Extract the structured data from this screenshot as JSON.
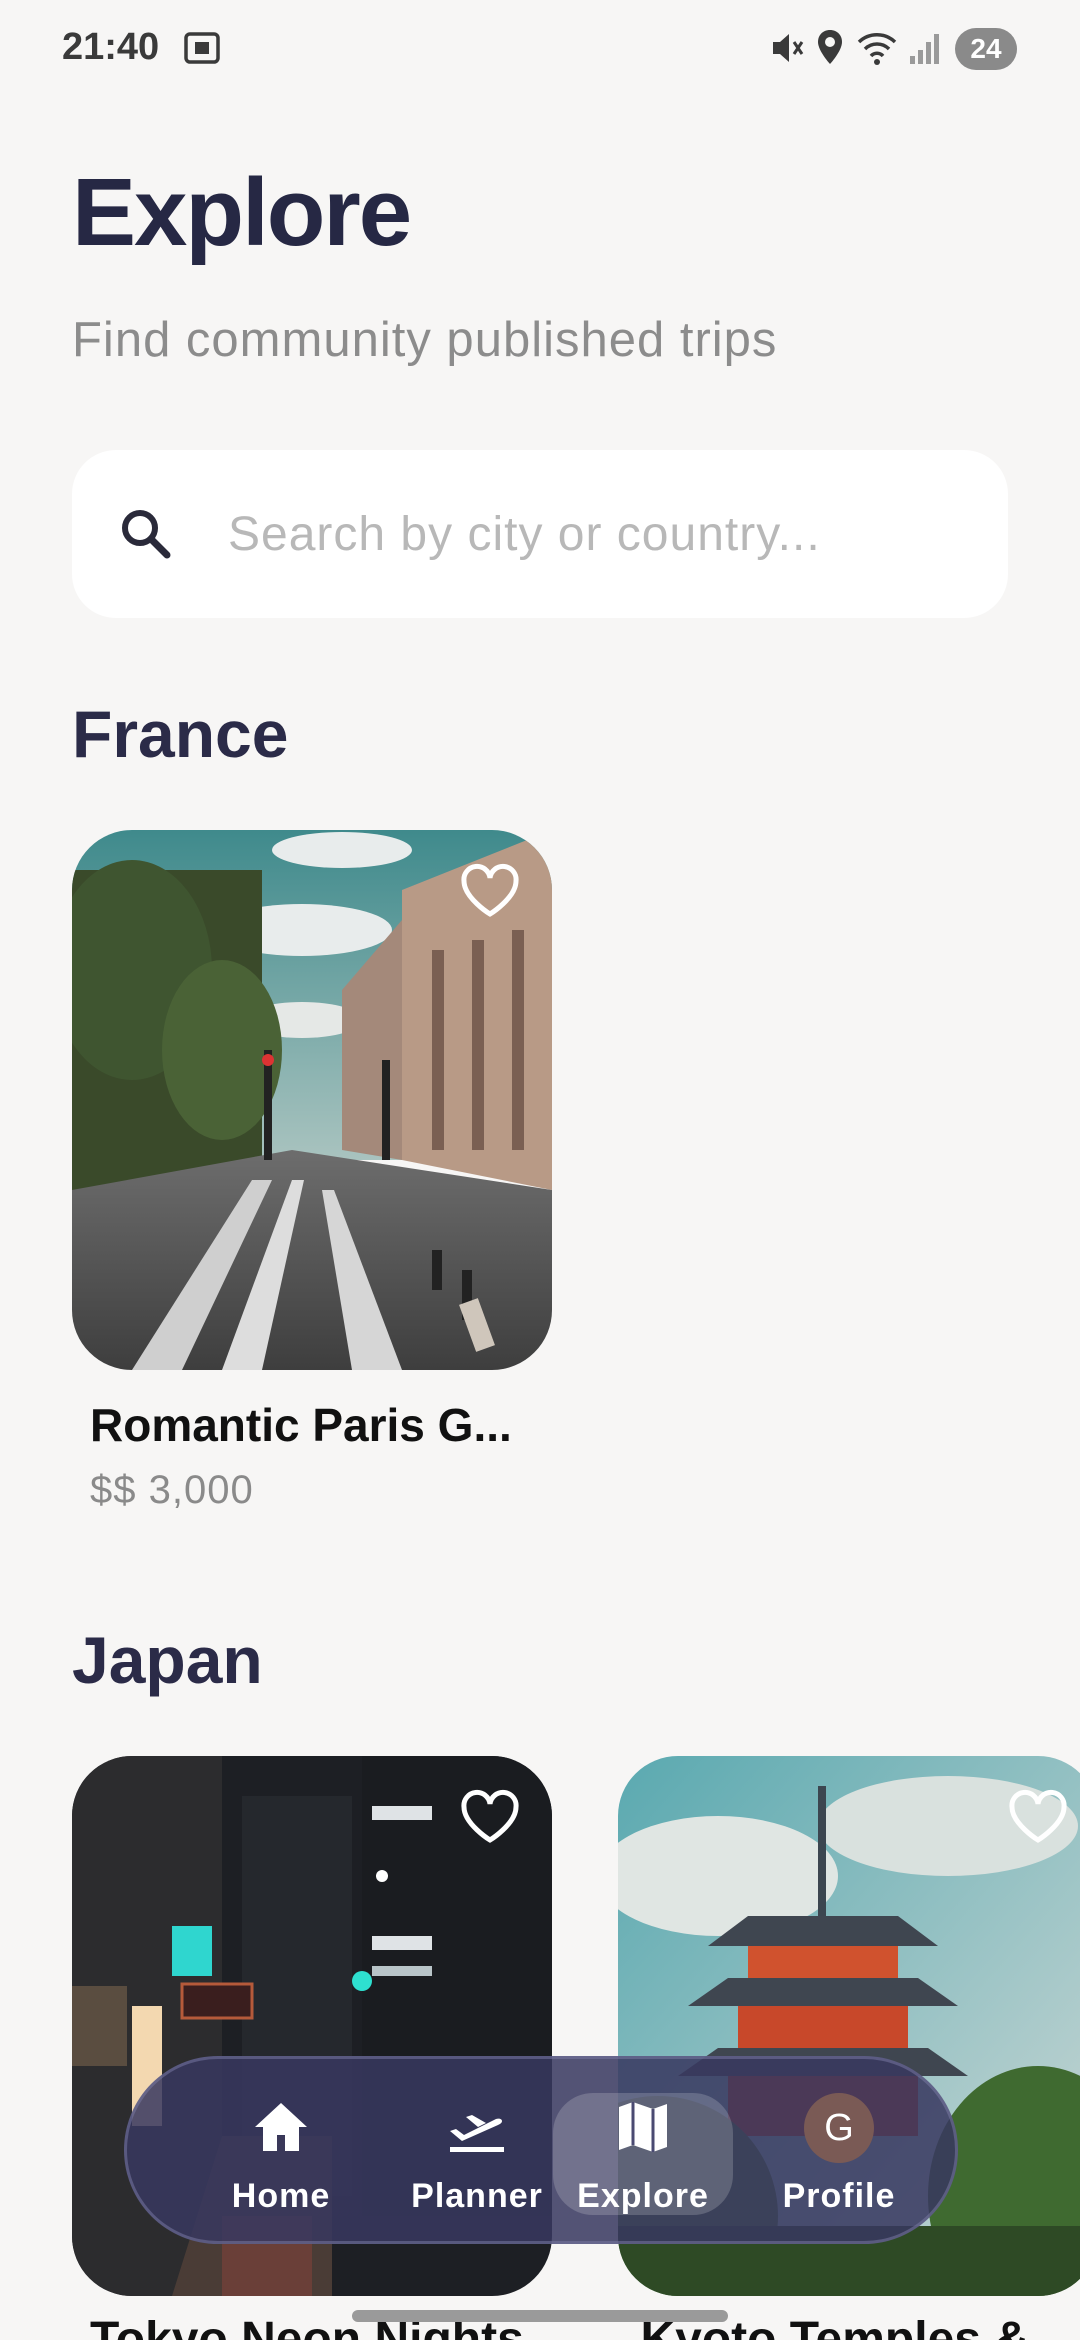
{
  "status_bar": {
    "time": "21:40",
    "battery": "24",
    "icons": [
      "screenshot-icon",
      "mute-icon",
      "location-icon",
      "wifi-icon",
      "signal-icon"
    ]
  },
  "header": {
    "title": "Explore",
    "subtitle": "Find community published trips"
  },
  "search": {
    "placeholder": "Search by city or country...",
    "value": ""
  },
  "sections": [
    {
      "title": "France",
      "trips": [
        {
          "name": "Romantic Paris G...",
          "price": "$$ 3,000",
          "favorited": false
        }
      ]
    },
    {
      "title": "Japan",
      "trips": [
        {
          "name": "Tokyo Neon Nights",
          "favorited": false
        },
        {
          "name": "Kyoto Temples &",
          "favorited": false
        }
      ]
    }
  ],
  "bottom_nav": {
    "items": [
      {
        "label": "Home",
        "icon": "home-icon"
      },
      {
        "label": "Planner",
        "icon": "plane-departure-icon"
      },
      {
        "label": "Explore",
        "icon": "map-icon",
        "active": true
      },
      {
        "label": "Profile",
        "avatar_letter": "G"
      }
    ]
  },
  "colors": {
    "background": "#f7f6f5",
    "title": "#262844",
    "nav_background": "#383860",
    "avatar": "#7a5a55"
  }
}
